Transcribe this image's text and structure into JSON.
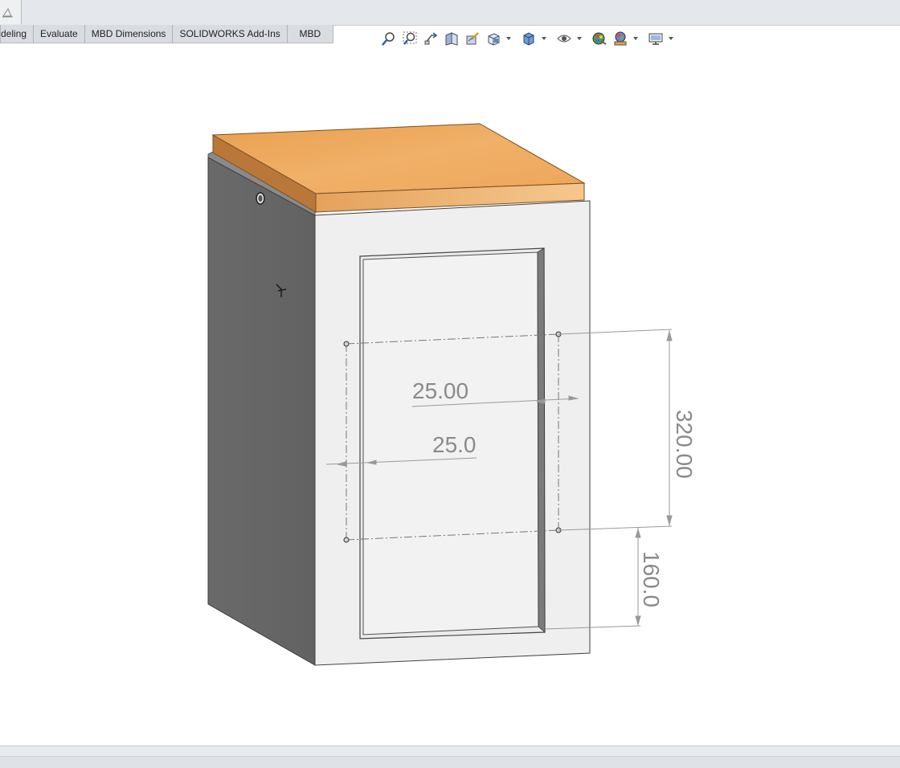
{
  "ribbon": {
    "tabs": [
      {
        "label": "deling"
      },
      {
        "label": "Evaluate"
      },
      {
        "label": "MBD Dimensions"
      },
      {
        "label": "SOLIDWORKS Add-Ins"
      },
      {
        "label": "MBD"
      }
    ]
  },
  "view_toolbar": {
    "icons": [
      "zoom-to-fit-icon",
      "zoom-to-area-icon",
      "previous-view-icon",
      "section-view-icon",
      "dynamic-annotation-views-icon",
      "view-orientation-icon",
      "display-style-icon",
      "hide-show-items-icon",
      "edit-appearance-icon",
      "apply-scene-icon",
      "view-settings-icon"
    ]
  },
  "model": {
    "part": "cabinet with wooden top and glass door",
    "colors": {
      "wood": "#e9a45a",
      "side": "#6e6e6e",
      "front": "#f0f0f0",
      "dimension": "#8a8a8a"
    }
  },
  "dimensions": {
    "dim_top_offset": "25.00",
    "dim_side_offset": "25.0",
    "dim_height": "320.00",
    "dim_bottom": "160.0"
  }
}
